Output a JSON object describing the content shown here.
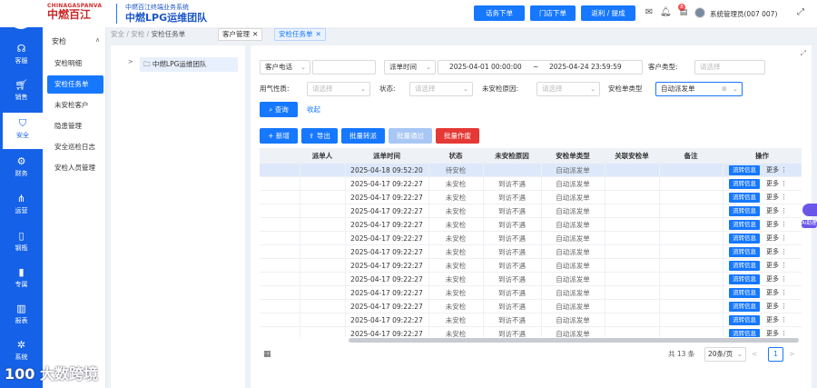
{
  "header": {
    "brand_en": "CHINAGASPANVA",
    "brand_cn": "中燃百江",
    "system_name": "中燃百江终端业务系统",
    "team_name": "中燃LPG运维团队",
    "buttons": [
      "话务下单",
      "门店下单",
      "返利 / 提成"
    ],
    "notification_count": "8",
    "user": "系统管理员(007 007)",
    "fullscreen_icon": "fullscreen-icon"
  },
  "nav": {
    "items": [
      {
        "label": "客服",
        "icon": "headset-icon"
      },
      {
        "label": "销售",
        "icon": "cart-icon"
      },
      {
        "label": "安全",
        "icon": "shield-icon"
      },
      {
        "label": "财务",
        "icon": "gear-icon"
      },
      {
        "label": "运营",
        "icon": "hierarchy-icon"
      },
      {
        "label": "钢瓶",
        "icon": "cylinder-icon"
      },
      {
        "label": "专属",
        "icon": "bar-icon"
      },
      {
        "label": "报表",
        "icon": "report-icon"
      },
      {
        "label": "系统",
        "icon": "settings-icon"
      }
    ],
    "active": "安全"
  },
  "submenu": {
    "title": "安检",
    "items": [
      "安检明细",
      "安检任务单",
      "未安检客户",
      "隐患管理",
      "安全巡检日志",
      "安检人员管理"
    ],
    "active": "安检任务单"
  },
  "breadcrumb": [
    "安全",
    "安检",
    "安检任务单"
  ],
  "tabs": [
    {
      "label": "客户管理"
    },
    {
      "label": "安检任务单"
    }
  ],
  "tree": {
    "node": "中燃LPG运维团队"
  },
  "filters": {
    "customer_phone": {
      "select": "客户电话",
      "value": ""
    },
    "dispatch_time": {
      "label": "派单时间",
      "start": "2025-04-01 00:00:00",
      "sep": "~",
      "end": "2025-04-24 23:59:59"
    },
    "customer_type": {
      "label": "客户类型:",
      "placeholder": "请选择"
    },
    "gas_nature": {
      "label": "用气性质:",
      "placeholder": "请选择"
    },
    "status": {
      "label": "状态:",
      "placeholder": "请选择"
    },
    "reason": {
      "label": "未安检原因:",
      "placeholder": "请选择"
    },
    "task_type": {
      "label": "安检单类型",
      "value": "自动派发单"
    },
    "query": "查询",
    "collapse": "收起"
  },
  "actions": {
    "add": "新增",
    "export": "导出",
    "batch_transfer": "批量转派",
    "batch_pass": "批量通过",
    "batch_void": "批量作废"
  },
  "table": {
    "columns": [
      "派单人",
      "派单时间",
      "状态",
      "未安检原因",
      "安检单类型",
      "关联安检单",
      "备注",
      "操作"
    ],
    "rows": [
      {
        "dispatcher": "",
        "time": "2025-04-18 09:52:20",
        "status": "待安检",
        "reason": "",
        "type": "自动派发单",
        "related": "",
        "note": "",
        "action": "流转信息",
        "more": "更多 ⋮"
      },
      {
        "dispatcher": "",
        "time": "2025-04-17 09:22:27",
        "status": "未安检",
        "reason": "到访不遇",
        "type": "自动派发单",
        "related": "",
        "note": "",
        "action": "流转信息",
        "more": "更多 ⋮"
      },
      {
        "dispatcher": "",
        "time": "2025-04-17 09:22:27",
        "status": "未安检",
        "reason": "到访不遇",
        "type": "自动派发单",
        "related": "",
        "note": "",
        "action": "流转信息",
        "more": "更多 ⋮"
      },
      {
        "dispatcher": "",
        "time": "2025-04-17 09:22:27",
        "status": "未安检",
        "reason": "到访不遇",
        "type": "自动派发单",
        "related": "",
        "note": "",
        "action": "流转信息",
        "more": "更多 ⋮"
      },
      {
        "dispatcher": "",
        "time": "2025-04-17 09:22:27",
        "status": "未安检",
        "reason": "到访不遇",
        "type": "自动派发单",
        "related": "",
        "note": "",
        "action": "流转信息",
        "more": "更多 ⋮"
      },
      {
        "dispatcher": "",
        "time": "2025-04-17 09:22:27",
        "status": "未安检",
        "reason": "到访不遇",
        "type": "自动派发单",
        "related": "",
        "note": "",
        "action": "流转信息",
        "more": "更多 ⋮"
      },
      {
        "dispatcher": "",
        "time": "2025-04-17 09:22:27",
        "status": "未安检",
        "reason": "到访不遇",
        "type": "自动派发单",
        "related": "",
        "note": "",
        "action": "流转信息",
        "more": "更多 ⋮"
      },
      {
        "dispatcher": "",
        "time": "2025-04-17 09:22:27",
        "status": "未安检",
        "reason": "到访不遇",
        "type": "自动派发单",
        "related": "",
        "note": "",
        "action": "流转信息",
        "more": "更多 ⋮"
      },
      {
        "dispatcher": "",
        "time": "2025-04-17 09:22:27",
        "status": "未安检",
        "reason": "到访不遇",
        "type": "自动派发单",
        "related": "",
        "note": "",
        "action": "流转信息",
        "more": "更多 ⋮"
      },
      {
        "dispatcher": "",
        "time": "2025-04-17 09:22:27",
        "status": "未安检",
        "reason": "到访不遇",
        "type": "自动派发单",
        "related": "",
        "note": "",
        "action": "流转信息",
        "more": "更多 ⋮"
      },
      {
        "dispatcher": "",
        "time": "2025-04-17 09:22:27",
        "status": "未安检",
        "reason": "到访不遇",
        "type": "自动派发单",
        "related": "",
        "note": "",
        "action": "流转信息",
        "more": "更多 ⋮"
      },
      {
        "dispatcher": "",
        "time": "2025-04-17 09:22:27",
        "status": "未安检",
        "reason": "到访不遇",
        "type": "自动派发单",
        "related": "",
        "note": "",
        "action": "流转信息",
        "more": "更多 ⋮"
      },
      {
        "dispatcher": "",
        "time": "2025-04-17 09:22:27",
        "status": "未安检",
        "reason": "到访不遇",
        "type": "自动派发单",
        "related": "",
        "note": "",
        "action": "流转信息",
        "more": "更多 ⋮"
      }
    ]
  },
  "pagination": {
    "total": "共 13 条",
    "page_size": "20条/页",
    "prev": "<",
    "page": "1",
    "next": ">"
  },
  "watermark": "100 大数跨境",
  "ai_tag": "AI助理"
}
